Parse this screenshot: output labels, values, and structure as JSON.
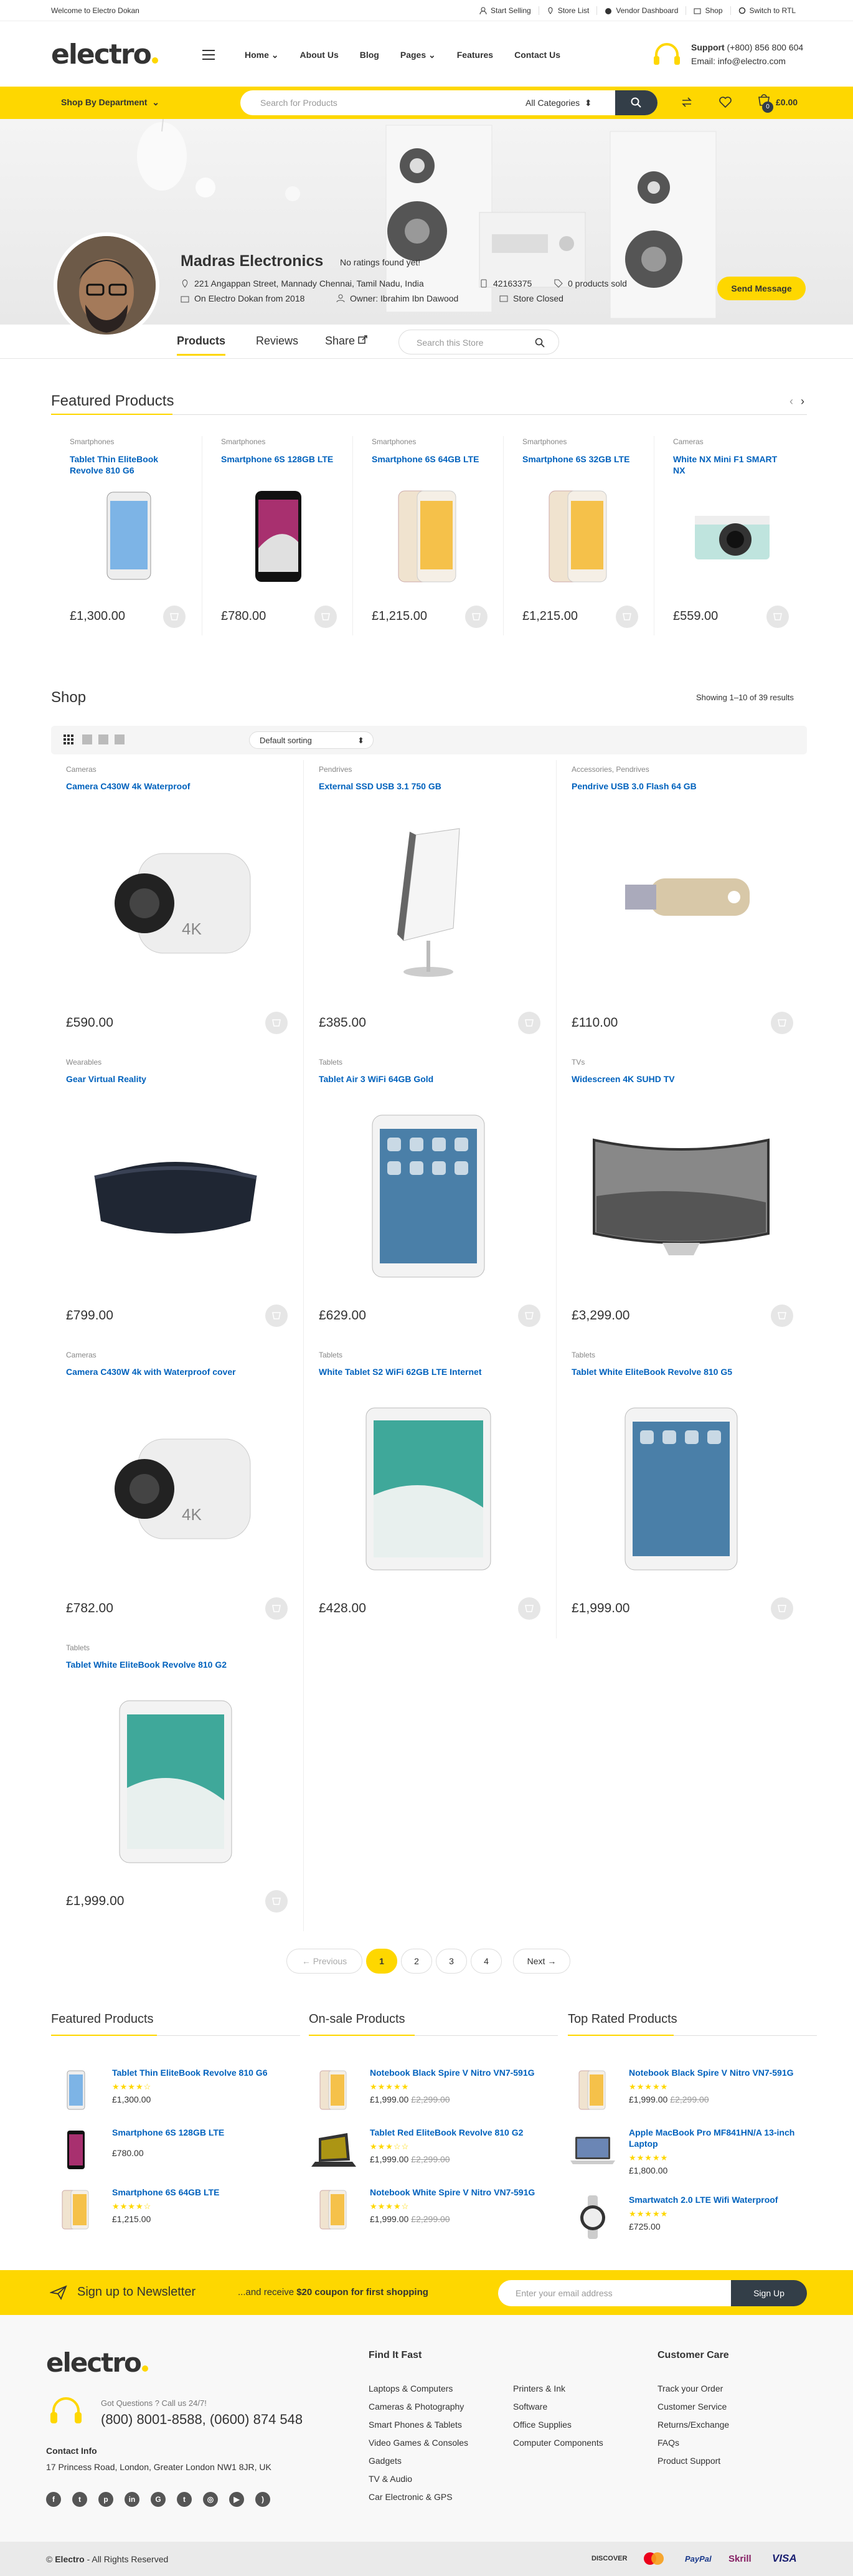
{
  "topbar": {
    "welcome": "Welcome to Electro Dokan",
    "links": [
      "Start Selling",
      "Store List",
      "Vendor Dashboard",
      "Shop",
      "Switch to RTL"
    ]
  },
  "header": {
    "logo": "electro",
    "nav": [
      "Home",
      "About Us",
      "Blog",
      "Pages",
      "Features",
      "Contact Us"
    ],
    "support_label": "Support",
    "support_phone": "(+800) 856 800 604",
    "support_email": "Email: info@electro.com"
  },
  "searchbar": {
    "dept": "Shop By Department",
    "placeholder": "Search for Products",
    "category": "All Categories",
    "cart_count": "0",
    "cart_total": "£0.00"
  },
  "store": {
    "name": "Madras Electronics",
    "rating": "No ratings found yet!",
    "address": "221 Angappan Street, Mannady Chennai, Tamil Nadu, India",
    "phone": "42163375",
    "sold": "0 products sold",
    "since": "On Electro Dokan from 2018",
    "owner": "Owner: Ibrahim Ibn Dawood",
    "status": "Store Closed",
    "send_btn": "Send Message",
    "tabs": [
      "Products",
      "Reviews",
      "Share"
    ],
    "search_placeholder": "Search this Store"
  },
  "featured": {
    "title": "Featured Products",
    "items": [
      {
        "cat": "Smartphones",
        "name": "Tablet Thin EliteBook Revolve 810 G6",
        "price": "£1,300.00"
      },
      {
        "cat": "Smartphones",
        "name": "Smartphone 6S 128GB LTE",
        "price": "£780.00"
      },
      {
        "cat": "Smartphones",
        "name": "Smartphone 6S 64GB LTE",
        "price": "£1,215.00"
      },
      {
        "cat": "Smartphones",
        "name": "Smartphone 6S 32GB LTE",
        "price": "£1,215.00"
      },
      {
        "cat": "Cameras",
        "name": "White NX Mini F1 SMART NX",
        "price": "£559.00"
      }
    ]
  },
  "shop": {
    "title": "Shop",
    "results": "Showing 1–10 of 39 results",
    "sort": "Default sorting",
    "products": [
      {
        "cat": "Cameras",
        "name": "Camera C430W 4k Waterproof",
        "price": "£590.00"
      },
      {
        "cat": "Pendrives",
        "name": "External SSD USB 3.1 750 GB",
        "price": "£385.00"
      },
      {
        "cat": "Accessories, Pendrives",
        "name": "Pendrive USB 3.0 Flash 64 GB",
        "price": "£110.00"
      },
      {
        "cat": "Wearables",
        "name": "Gear Virtual Reality",
        "price": "£799.00"
      },
      {
        "cat": "Tablets",
        "name": "Tablet Air 3 WiFi 64GB Gold",
        "price": "£629.00"
      },
      {
        "cat": "TVs",
        "name": "Widescreen 4K SUHD TV",
        "price": "£3,299.00"
      },
      {
        "cat": "Cameras",
        "name": "Camera C430W 4k with Waterproof cover",
        "price": "£782.00"
      },
      {
        "cat": "Tablets",
        "name": "White Tablet S2 WiFi 62GB LTE Internet",
        "price": "£428.00"
      },
      {
        "cat": "Tablets",
        "name": "Tablet White EliteBook Revolve 810 G5",
        "price": "£1,999.00"
      },
      {
        "cat": "Tablets",
        "name": "Tablet White EliteBook Revolve 810 G2",
        "price": "£1,999.00"
      }
    ],
    "pagination": [
      "← Previous",
      "1",
      "2",
      "3",
      "4",
      "Next →"
    ]
  },
  "widgets": [
    {
      "title": "Featured Products",
      "items": [
        {
          "name": "Tablet Thin EliteBook Revolve 810 G6",
          "stars": 4,
          "price": "£1,300.00",
          "old": ""
        },
        {
          "name": "Smartphone 6S 128GB LTE",
          "stars": 0,
          "price": "£780.00",
          "old": ""
        },
        {
          "name": "Smartphone 6S 64GB LTE",
          "stars": 4,
          "price": "£1,215.00",
          "old": ""
        }
      ]
    },
    {
      "title": "On-sale Products",
      "items": [
        {
          "name": "Notebook Black Spire V Nitro VN7-591G",
          "stars": 5,
          "price": "£1,999.00",
          "old": "£2,299.00"
        },
        {
          "name": "Tablet Red EliteBook Revolve 810 G2",
          "stars": 3,
          "price": "£1,999.00",
          "old": "£2,299.00"
        },
        {
          "name": "Notebook White Spire V Nitro VN7-591G",
          "stars": 4,
          "price": "£1,999.00",
          "old": "£2,299.00"
        }
      ]
    },
    {
      "title": "Top Rated Products",
      "items": [
        {
          "name": "Notebook Black Spire V Nitro VN7-591G",
          "stars": 5,
          "price": "£1,999.00",
          "old": "£2,299.00"
        },
        {
          "name": "Apple MacBook Pro MF841HN/A 13-inch Laptop",
          "stars": 5,
          "price": "£1,800.00",
          "old": ""
        },
        {
          "name": "Smartwatch 2.0 LTE Wifi Waterproof",
          "stars": 5,
          "price": "£725.00",
          "old": ""
        }
      ]
    }
  ],
  "newsletter": {
    "title": "Sign up to Newsletter",
    "sub_pre": "...and receive ",
    "sub_bold": "$20 coupon for first shopping",
    "placeholder": "Enter your email address",
    "button": "Sign Up"
  },
  "footer": {
    "logo": "electro",
    "questions": "Got Questions ? Call us 24/7!",
    "phones": "(800) 8001-8588, (0600) 874 548",
    "contact_title": "Contact Info",
    "address": "17 Princess Road, London, Greater London NW1 8JR, UK",
    "find_title": "Find It Fast",
    "find_col1": [
      "Laptops & Computers",
      "Cameras & Photography",
      "Smart Phones & Tablets",
      "Video Games & Consoles",
      "Gadgets",
      "TV & Audio",
      "Car Electronic & GPS"
    ],
    "find_col2": [
      "Printers & Ink",
      "Software",
      "Office Supplies",
      "Computer Components"
    ],
    "care_title": "Customer Care",
    "care": [
      "Track your Order",
      "Customer Service",
      "Returns/Exchange",
      "FAQs",
      "Product Support"
    ],
    "copyright_brand": "Electro",
    "copyright_rest": " - All Rights Reserved",
    "copyright_sym": "©",
    "payments": [
      "DISCOVER",
      "mastercard",
      "PayPal",
      "Skrill",
      "VISA"
    ]
  },
  "colors": {
    "accent": "#fed700",
    "link": "#0062bd",
    "dark": "#333e48"
  }
}
